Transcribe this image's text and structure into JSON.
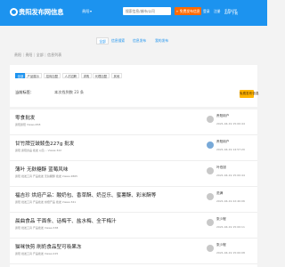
{
  "header": {
    "logo_text": "贵阳发布网信息",
    "region": "贵阳",
    "search_placeholder": "搜索信息/城市/公司",
    "publish_label": "+ 免费发布信息",
    "login_label": "登录",
    "register_label": "注册",
    "app_label": "手机APP",
    "app_label2": "APP 下载"
  },
  "nav": {
    "tabs": [
      {
        "label": "全部"
      },
      {
        "label": "信息搜索"
      },
      {
        "label": "信息发布"
      },
      {
        "label": "我的发布"
      }
    ]
  },
  "breadcrumb": [
    "贵阳",
    "贵阳",
    "全部",
    "信息列表"
  ],
  "filters": {
    "tags": [
      "全部",
      "产品展示",
      "招商加盟",
      "人才招聘",
      "求购",
      "代理加盟",
      "其他"
    ],
    "current_label": "当前标签：",
    "count_text": "本次找到数 23 条",
    "publish_button": "免费发布信息"
  },
  "listings": [
    {
      "title": "零食批发",
      "meta": "贵阳贵阳  Views:458",
      "poster": "贵阳用户",
      "time": "2021-04-19 15:00:44"
    },
    {
      "title": "甘竹牌豆豉鲮鱼227g 批发",
      "meta": "贵阳 贵阳食品 批发 以及...  Views:322",
      "poster": "贵阳用户",
      "time": "2021-04-19 14:57:20"
    },
    {
      "title": "薄叶 无麸糖酥 蓝莓风味",
      "meta": "贵阳 批发工具 产品批发 无麸糖酥 批发 Views:2865",
      "poster": "叶伯旭",
      "time": "2021-04-19 15:00:44"
    },
    {
      "title": "福吉珍 烘焙产品：酸奶包、香草酥、奶豆乐、蜜薯酥、彩米酥等",
      "meta": "贵阳 批发工具 产品批发 烘焙产品 批发 Views:341",
      "poster": "范满",
      "time": "2021-04-19 22:40:06"
    },
    {
      "title": "晨曲食品 干面条、话梅干、盐水梅、全干梅汁",
      "meta": "贵阳 批发工具 产品批发  Views:338",
      "poster": "张少程",
      "time": "2021-04-19 15:00:11"
    },
    {
      "title": "猫咪快剪 刷奶食品型可吸果冻",
      "meta": "贵阳 批发工具 产品批发  Views:225",
      "poster": "张少程",
      "time": "2021-04-19 15:00:08"
    }
  ],
  "colors": {
    "header_bg": "#1c93ef",
    "accent_orange": "#ff6a00",
    "publish_yellow": "#ffb400"
  }
}
